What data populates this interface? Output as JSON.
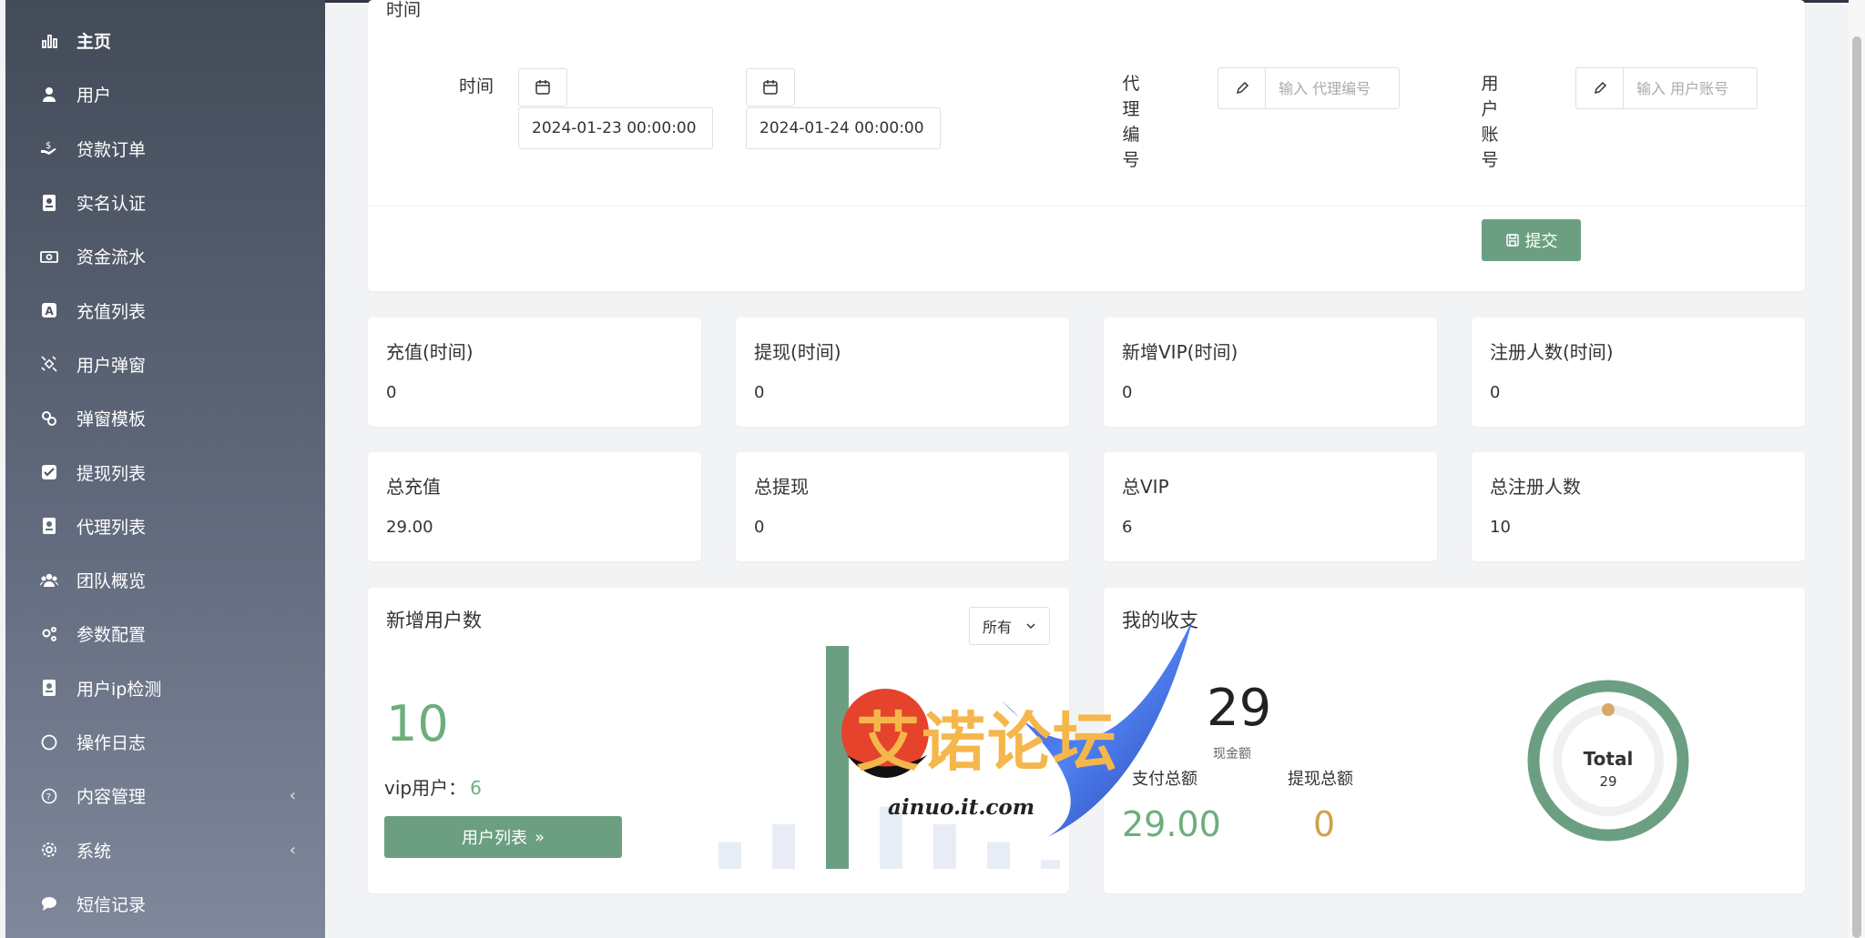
{
  "sidebar": {
    "items": [
      {
        "label": "主页",
        "icon": "bar-chart-icon"
      },
      {
        "label": "用户",
        "icon": "user-icon"
      },
      {
        "label": "贷款订单",
        "icon": "money-hand-icon"
      },
      {
        "label": "实名认证",
        "icon": "id-card-icon"
      },
      {
        "label": "资金流水",
        "icon": "cash-icon"
      },
      {
        "label": "充值列表",
        "icon": "badge-a-icon"
      },
      {
        "label": "用户弹窗",
        "icon": "satellite-icon"
      },
      {
        "label": "弹窗模板",
        "icon": "link-icon"
      },
      {
        "label": "提现列表",
        "icon": "check-square-icon"
      },
      {
        "label": "代理列表",
        "icon": "contact-icon"
      },
      {
        "label": "团队概览",
        "icon": "users-icon"
      },
      {
        "label": "参数配置",
        "icon": "cogs-icon"
      },
      {
        "label": "用户ip检测",
        "icon": "contact-icon"
      },
      {
        "label": "操作日志",
        "icon": "circle-icon"
      },
      {
        "label": "内容管理",
        "icon": "question-circle-icon",
        "chevron": "‹"
      },
      {
        "label": "系统",
        "icon": "gear-icon",
        "chevron": "‹"
      },
      {
        "label": "短信记录",
        "icon": "chat-icon"
      }
    ]
  },
  "filter": {
    "heading": "时间",
    "time_label": "时间",
    "start_time": "2024-01-23 00:00:00",
    "end_time": "2024-01-24 00:00:00",
    "agent_label_chars": [
      "代",
      "理",
      "编",
      "号"
    ],
    "agent_placeholder": "输入 代理编号",
    "user_label_chars": [
      "用",
      "户",
      "账",
      "号"
    ],
    "user_placeholder": "输入 用户账号",
    "submit_label": "提交"
  },
  "stats": {
    "recharge_period": {
      "title": "充值(时间)",
      "value": "0"
    },
    "withdraw_period": {
      "title": "提现(时间)",
      "value": "0"
    },
    "new_vip_period": {
      "title": "新增VIP(时间)",
      "value": "0"
    },
    "register_period": {
      "title": "注册人数(时间)",
      "value": "0"
    },
    "total_recharge": {
      "title": "总充值",
      "value": "29.00"
    },
    "total_withdraw": {
      "title": "总提现",
      "value": "0"
    },
    "total_vip": {
      "title": "总VIP",
      "value": "6"
    },
    "total_register": {
      "title": "总注册人数",
      "value": "10"
    }
  },
  "new_users": {
    "title": "新增用户数",
    "filter_value": "所有",
    "count": "10",
    "vip_label": "vip用户：",
    "vip_count": "6",
    "list_button": "用户列表",
    "chart_data": {
      "type": "bar",
      "values": [
        3,
        5,
        25,
        7,
        5,
        3,
        1
      ]
    }
  },
  "finance": {
    "title": "我的收支",
    "balance": "29",
    "balance_label": "现金额",
    "pay_label": "支付总额",
    "pay_value": "29.00",
    "withdraw_label": "提现总额",
    "withdraw_value": "0",
    "donut_title": "Total",
    "donut_value": "29"
  },
  "watermark": {
    "text": "艾诺论坛",
    "url": "ainuo.it.com"
  },
  "colors": {
    "accent": "#6c9f82",
    "green_text": "#6cae7c",
    "gold_text": "#d0a24c"
  }
}
